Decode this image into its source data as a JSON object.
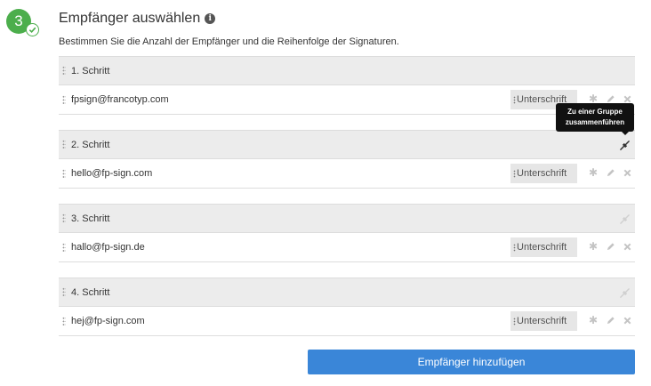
{
  "section": {
    "number": "3",
    "title": "Empfänger auswählen",
    "description": "Bestimmen Sie die Anzahl der Empfänger und die Reihenfolge der Signaturen."
  },
  "steps": [
    {
      "label": "1. Schritt",
      "email": "fpsign@francotyp.com",
      "role": "Unterschrift",
      "merge_active": false
    },
    {
      "label": "2. Schritt",
      "email": "hello@fp-sign.com",
      "role": "Unterschrift",
      "merge_active": true
    },
    {
      "label": "3. Schritt",
      "email": "hallo@fp-sign.de",
      "role": "Unterschrift",
      "merge_active": false
    },
    {
      "label": "4. Schritt",
      "email": "hej@fp-sign.com",
      "role": "Unterschrift",
      "merge_active": false
    }
  ],
  "tooltip": {
    "line1": "Zu einer Gruppe",
    "line2": "zusammenführen"
  },
  "add_button_label": "Empfänger hinzufügen",
  "colors": {
    "success": "#4cae4c",
    "primary": "#3a86d8",
    "header_bg": "#ececec"
  },
  "icons": [
    "check-icon",
    "info-icon",
    "drag-handle-icon",
    "merge-icon",
    "settings-icon",
    "edit-icon",
    "delete-icon"
  ]
}
